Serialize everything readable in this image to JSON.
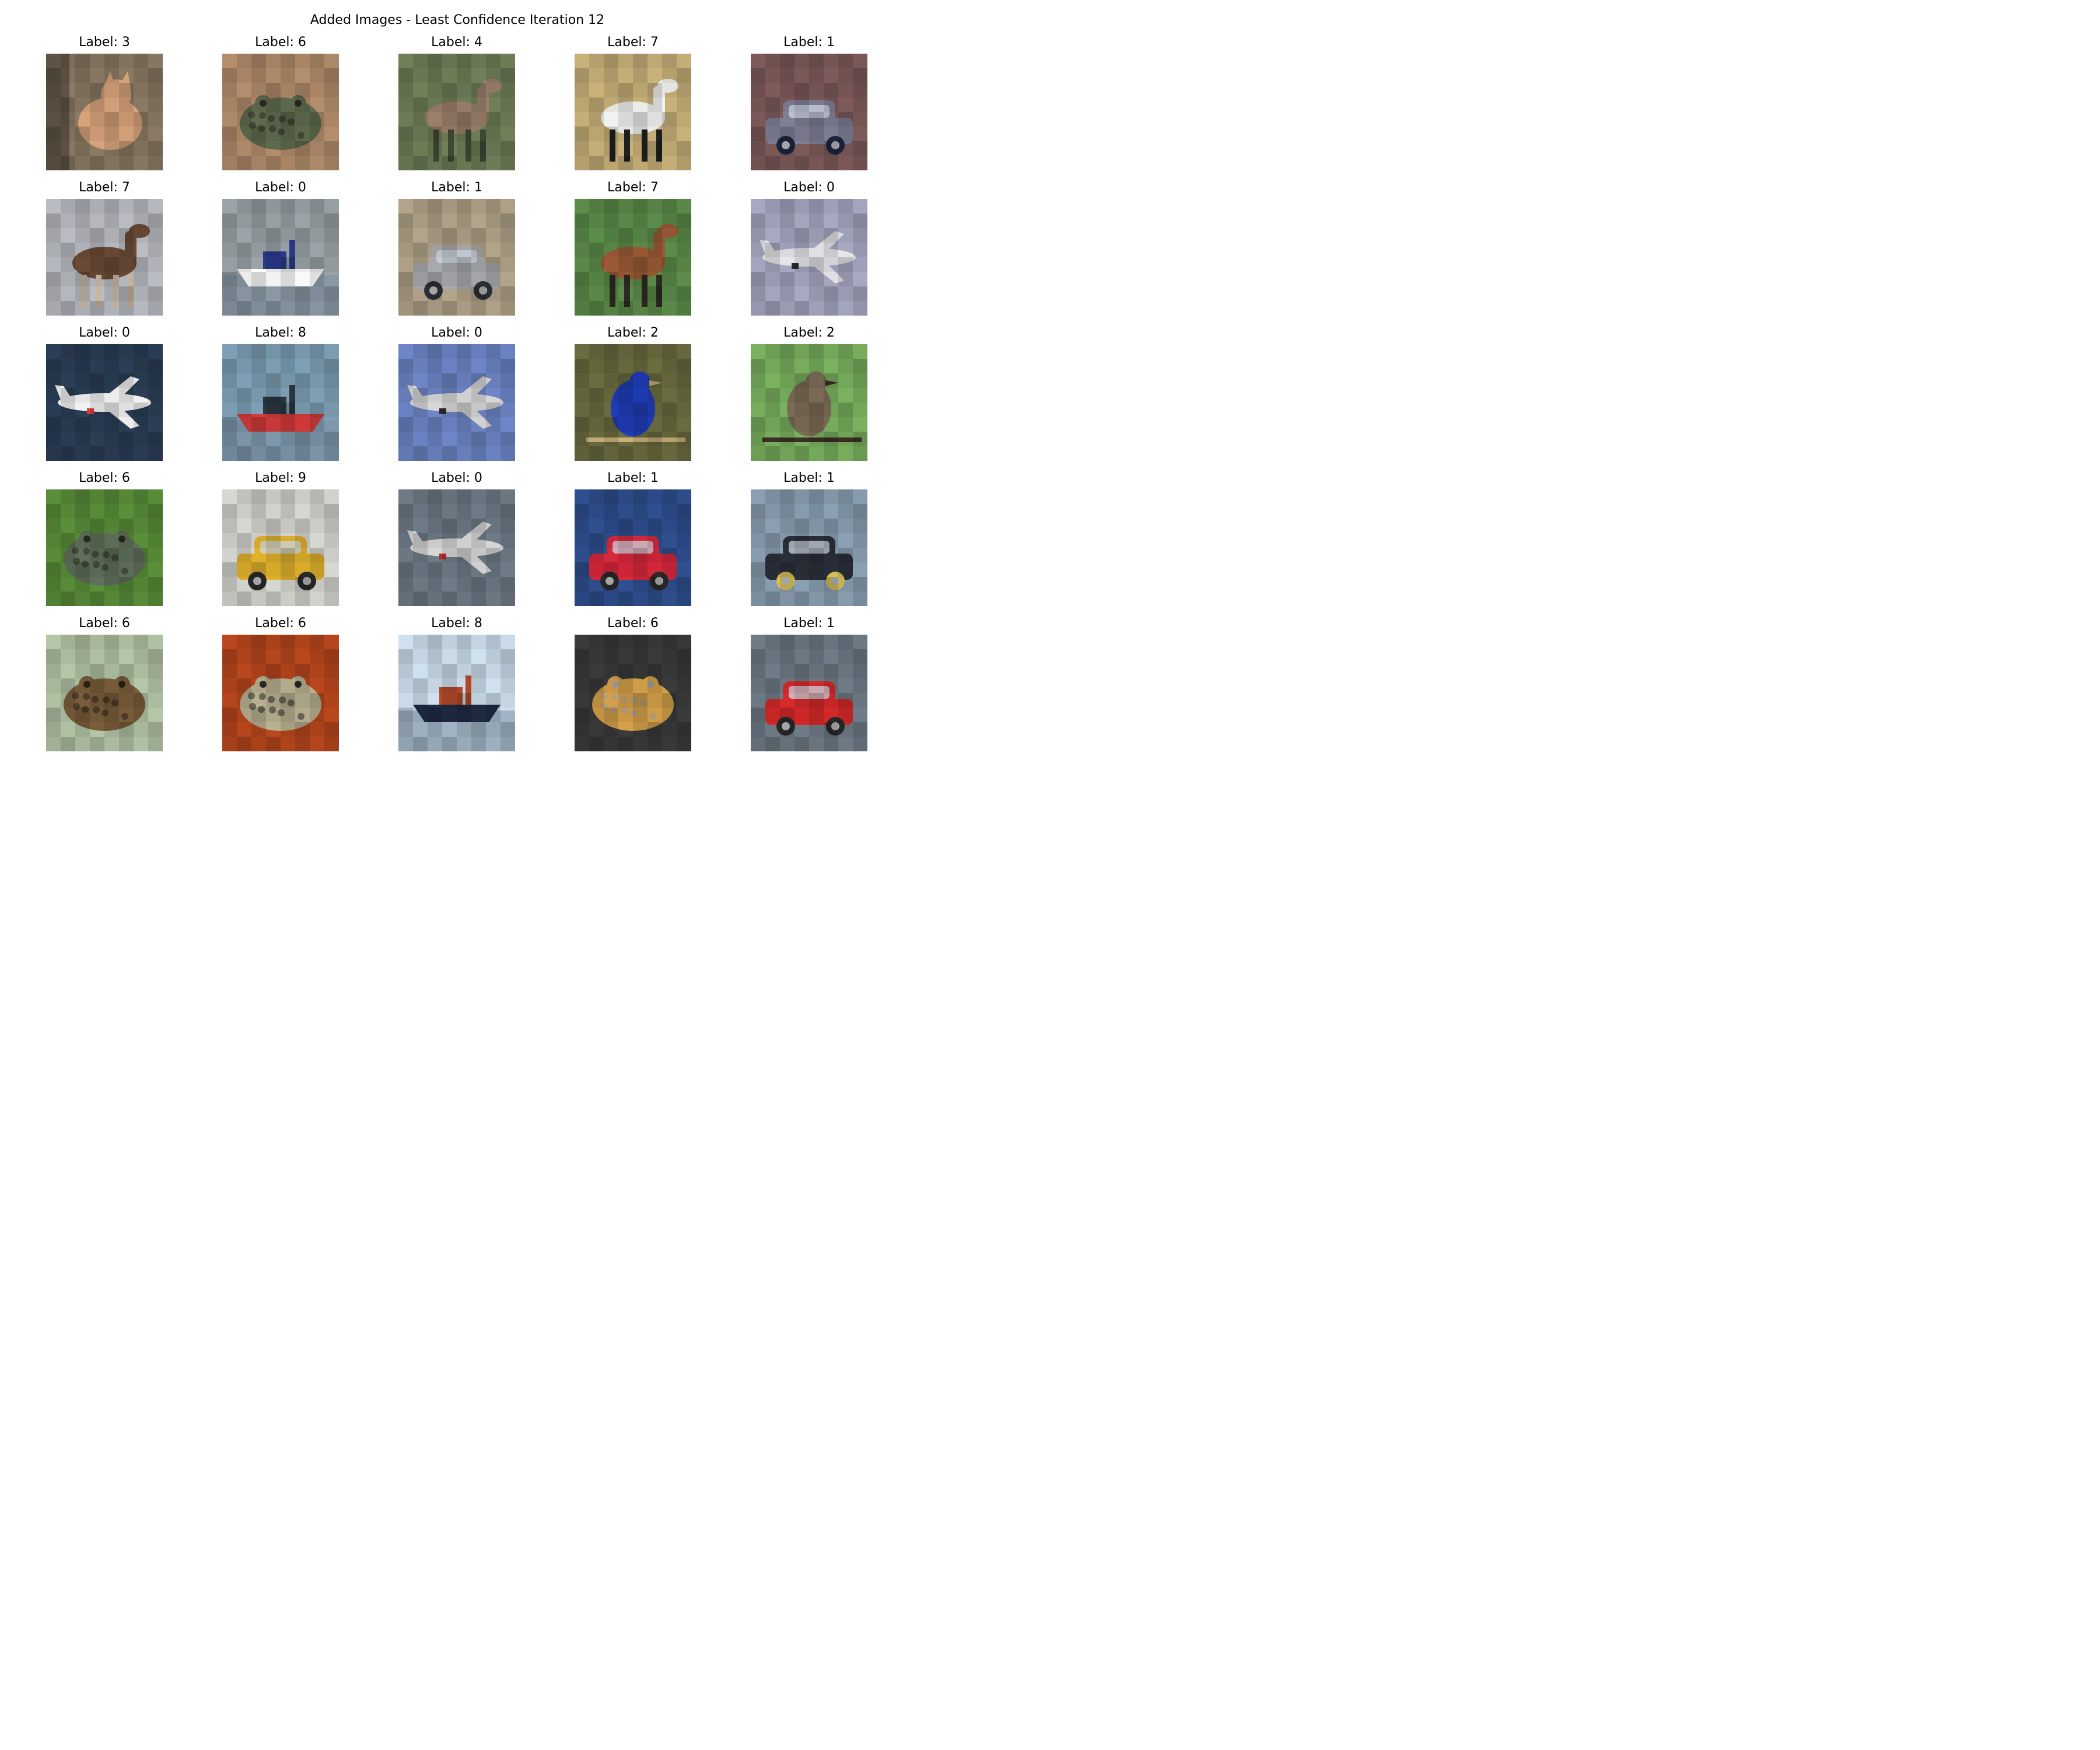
{
  "figure": {
    "title": "Added Images - Least Confidence Iteration 12"
  },
  "images": [
    {
      "label": "Label: 3",
      "subject": "cat",
      "bg": "#8a7a63",
      "fg": "#d6a27a",
      "accent": "#3a332c"
    },
    {
      "label": "Label: 6",
      "subject": "frog",
      "bg": "#b38d6c",
      "fg": "#5f6b4e",
      "accent": "#2b2b24"
    },
    {
      "label": "Label: 4",
      "subject": "deer",
      "bg": "#6f7f58",
      "fg": "#9a7f6a",
      "accent": "#3f4a35"
    },
    {
      "label": "Label: 7",
      "subject": "horse",
      "bg": "#c9b27a",
      "fg": "#f1f1ef",
      "accent": "#1f1f1f"
    },
    {
      "label": "Label: 1",
      "subject": "automobile",
      "bg": "#7e5a5a",
      "fg": "#7f7f95",
      "accent": "#1c2540"
    },
    {
      "label": "Label: 7",
      "subject": "horse",
      "bg": "#b9bcc2",
      "fg": "#6a4a36",
      "accent": "#c9b7a0"
    },
    {
      "label": "Label: 0",
      "subject": "boat",
      "bg": "#9aa3a7",
      "fg": "#ffffff",
      "accent": "#2a3a8c"
    },
    {
      "label": "Label: 1",
      "subject": "automobile",
      "bg": "#b2a48a",
      "fg": "#a8a9ad",
      "accent": "#2c3138"
    },
    {
      "label": "Label: 7",
      "subject": "horse",
      "bg": "#5c8c4a",
      "fg": "#9b5a35",
      "accent": "#2d2a21"
    },
    {
      "label": "Label: 0",
      "subject": "airplane",
      "bg": "#a7a8c2",
      "fg": "#e6e6ea",
      "accent": "#2a2a2a"
    },
    {
      "label": "Label: 0",
      "subject": "airplane",
      "bg": "#2b3e55",
      "fg": "#f2f2f2",
      "accent": "#d83a3a"
    },
    {
      "label": "Label: 8",
      "subject": "boat",
      "bg": "#7ea0b6",
      "fg": "#d23b3b",
      "accent": "#2a3640"
    },
    {
      "label": "Label: 0",
      "subject": "airplane",
      "bg": "#6e86c7",
      "fg": "#d7d7d7",
      "accent": "#2a2a2a"
    },
    {
      "label": "Label: 2",
      "subject": "bird",
      "bg": "#6a6b3f",
      "fg": "#1f3cb5",
      "accent": "#c8b07a"
    },
    {
      "label": "Label: 2",
      "subject": "bird",
      "bg": "#79b15e",
      "fg": "#7c6c55",
      "accent": "#3c2f27"
    },
    {
      "label": "Label: 6",
      "subject": "frog",
      "bg": "#5a8f3a",
      "fg": "#5f6f5a",
      "accent": "#2a2b22"
    },
    {
      "label": "Label: 9",
      "subject": "truck",
      "bg": "#d7d7d2",
      "fg": "#e0b12c",
      "accent": "#2a2a2a"
    },
    {
      "label": "Label: 0",
      "subject": "airplane",
      "bg": "#6e7b86",
      "fg": "#d6d6d6",
      "accent": "#b52a2a"
    },
    {
      "label": "Label: 1",
      "subject": "automobile",
      "bg": "#2f4f8f",
      "fg": "#d8283c",
      "accent": "#2a2a2a"
    },
    {
      "label": "Label: 1",
      "subject": "automobile",
      "bg": "#8a9fb2",
      "fg": "#2b2f3a",
      "accent": "#d9c25a"
    },
    {
      "label": "Label: 6",
      "subject": "frog",
      "bg": "#b4c6a7",
      "fg": "#7a5d3a",
      "accent": "#2a2218"
    },
    {
      "label": "Label: 6",
      "subject": "frog",
      "bg": "#b9471e",
      "fg": "#b8b08f",
      "accent": "#2a2a2a"
    },
    {
      "label": "Label: 8",
      "subject": "ship",
      "bg": "#cfe0ef",
      "fg": "#1f2a44",
      "accent": "#b44a2a"
    },
    {
      "label": "Label: 6",
      "subject": "frog",
      "bg": "#3a3a3a",
      "fg": "#d4a04a",
      "accent": "#9c9c9c"
    },
    {
      "label": "Label: 1",
      "subject": "automobile",
      "bg": "#6f7b86",
      "fg": "#d62a2a",
      "accent": "#2a2a2a"
    }
  ]
}
